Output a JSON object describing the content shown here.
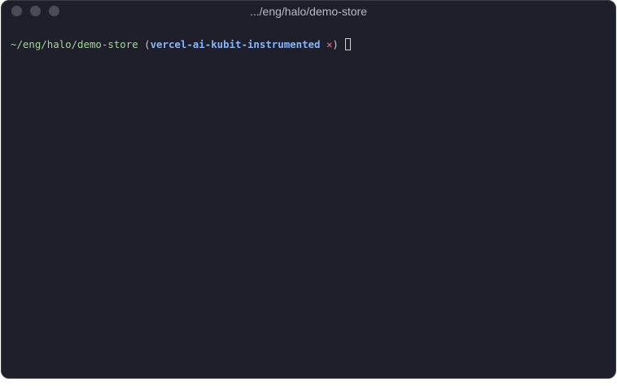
{
  "window": {
    "title": ".../eng/halo/demo-store"
  },
  "terminal": {
    "prompt": {
      "path": "~/eng/halo/demo-store",
      "branch_open": "(",
      "branch": "vercel-ai-kubit-instrumented",
      "dirty_marker": "✕",
      "branch_close": ")"
    }
  },
  "colors": {
    "background": "#1e1f2b",
    "path": "#a6d49a",
    "branch": "#8ab4f8",
    "dirty": "#f07178"
  }
}
